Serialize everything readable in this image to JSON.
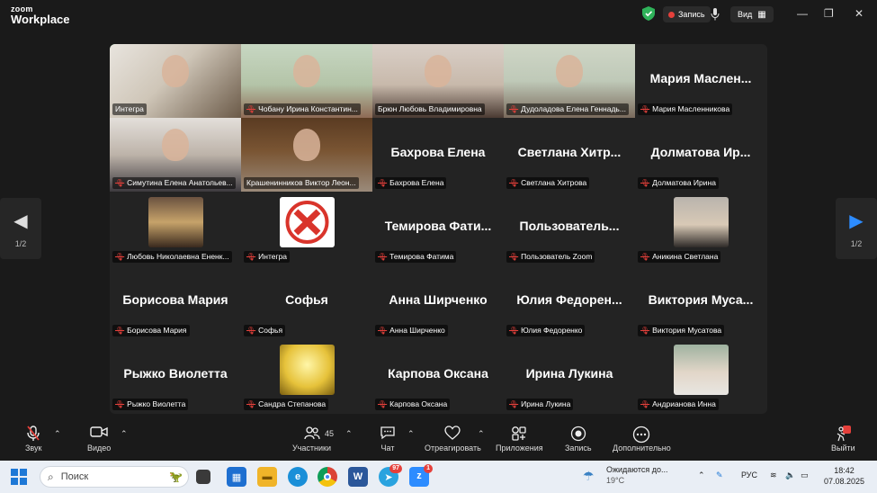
{
  "titlebar": {
    "logo_line1": "zoom",
    "logo_line2": "Workplace",
    "record_label": "Запись",
    "view_label": "Вид",
    "minimize": "—",
    "restore": "❐",
    "close": "✕"
  },
  "tiles": [
    {
      "label": "Интегра",
      "big": "",
      "video": "room1",
      "active": true,
      "muted": false
    },
    {
      "label": "Чобану Ирина Константин...",
      "big": "",
      "video": "woman-red",
      "active": false,
      "muted": true
    },
    {
      "label": "Брюн Любовь Владимировна",
      "big": "",
      "video": "woman-dark",
      "active": false,
      "muted": false
    },
    {
      "label": "Дудоладова Елена Геннадь...",
      "big": "",
      "video": "woman-blonde",
      "active": false,
      "muted": true
    },
    {
      "label": "Мария Масленникова",
      "big": "Мария Маслен...",
      "video": "",
      "active": false,
      "muted": true
    },
    {
      "label": "Симутина Елена Анатольев...",
      "big": "",
      "video": "woman-glasses",
      "active": false,
      "muted": true
    },
    {
      "label": "Крашенинников Виктор Леон...",
      "big": "",
      "video": "man-shelves",
      "active": false,
      "muted": false
    },
    {
      "label": "Бахрова Елена",
      "big": "Бахрова Елена",
      "video": "",
      "active": false,
      "muted": true
    },
    {
      "label": "Светлана Хитрова",
      "big": "Светлана Хитр...",
      "video": "",
      "active": false,
      "muted": true
    },
    {
      "label": "Долматова Ирина",
      "big": "Долматова Ир...",
      "video": "",
      "active": false,
      "muted": true
    },
    {
      "label": "Любовь Николаевна Ененк...",
      "big": "",
      "video": "thumb-woman-room",
      "active": false,
      "muted": true
    },
    {
      "label": "Интегра",
      "big": "",
      "video": "thumb-logo",
      "active": false,
      "muted": true
    },
    {
      "label": "Темирова Фатима",
      "big": "Темирова Фати...",
      "video": "",
      "active": false,
      "muted": true
    },
    {
      "label": "Пользователь Zoom",
      "big": "Пользователь...",
      "video": "",
      "active": false,
      "muted": true
    },
    {
      "label": "Аникина Светлана",
      "big": "",
      "video": "thumb-woman",
      "active": false,
      "muted": true
    },
    {
      "label": "Борисова Мария",
      "big": "Борисова Мария",
      "video": "",
      "active": false,
      "muted": true
    },
    {
      "label": "Софья",
      "big": "Софья",
      "video": "",
      "active": false,
      "muted": true
    },
    {
      "label": "Анна Ширченко",
      "big": "Анна Ширченко",
      "video": "",
      "active": false,
      "muted": true
    },
    {
      "label": "Юлия Федоренко",
      "big": "Юлия Федорен...",
      "video": "",
      "active": false,
      "muted": true
    },
    {
      "label": "Виктория Мусатова",
      "big": "Виктория Муса...",
      "video": "",
      "active": false,
      "muted": true
    },
    {
      "label": "Рыжко Виолетта",
      "big": "Рыжко Виолетта",
      "video": "",
      "active": false,
      "muted": true
    },
    {
      "label": "Сандра Степанова",
      "big": "",
      "video": "thumb-yellow",
      "active": false,
      "muted": true
    },
    {
      "label": "Карпова Оксана",
      "big": "Карпова Оксана",
      "video": "",
      "active": false,
      "muted": true
    },
    {
      "label": "Ирина Лукина",
      "big": "Ирина Лукина",
      "video": "",
      "active": false,
      "muted": true
    },
    {
      "label": "Андрианова Инна",
      "big": "",
      "video": "thumb-woman2",
      "active": false,
      "muted": true
    }
  ],
  "pager": {
    "left_page": "1/2",
    "right_page": "1/2"
  },
  "toolbar": {
    "audio": "Звук",
    "video": "Видео",
    "participants": "Участники",
    "participants_count": "45",
    "chat": "Чат",
    "react": "Отреагировать",
    "apps": "Приложения",
    "record": "Запись",
    "more": "Дополнительно",
    "leave": "Выйти"
  },
  "taskbar": {
    "search_placeholder": "Поиск",
    "telegram_badge": "97",
    "zoom_badge": "1",
    "weather_text": "Ожидаются до...",
    "temperature": "19°C",
    "language": "РУС",
    "time": "18:42",
    "date": "07.08.2025"
  },
  "colors": {
    "accent_blue": "#2d8cff",
    "recording_red": "#e5403b",
    "active_speaker": "#5bd07a",
    "shield_green": "#2fb35a"
  }
}
